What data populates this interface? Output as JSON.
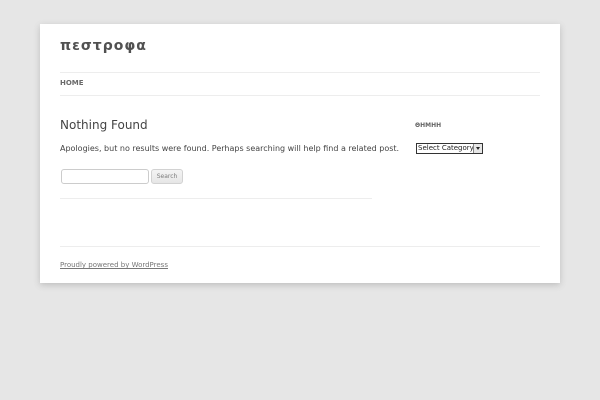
{
  "site": {
    "title": "πεστροφα"
  },
  "nav": {
    "items": [
      {
        "label": "Home"
      }
    ]
  },
  "content": {
    "title": "Nothing Found",
    "text": "Apologies, but no results were found. Perhaps searching will help find a related post.",
    "search": {
      "placeholder": "",
      "value": "",
      "button_label": "Search"
    }
  },
  "sidebar": {
    "widget_title": "ΘΗΜΗΗ",
    "category_select": {
      "selected": "Select Category"
    }
  },
  "footer": {
    "credit": "Proudly powered by WordPress"
  }
}
